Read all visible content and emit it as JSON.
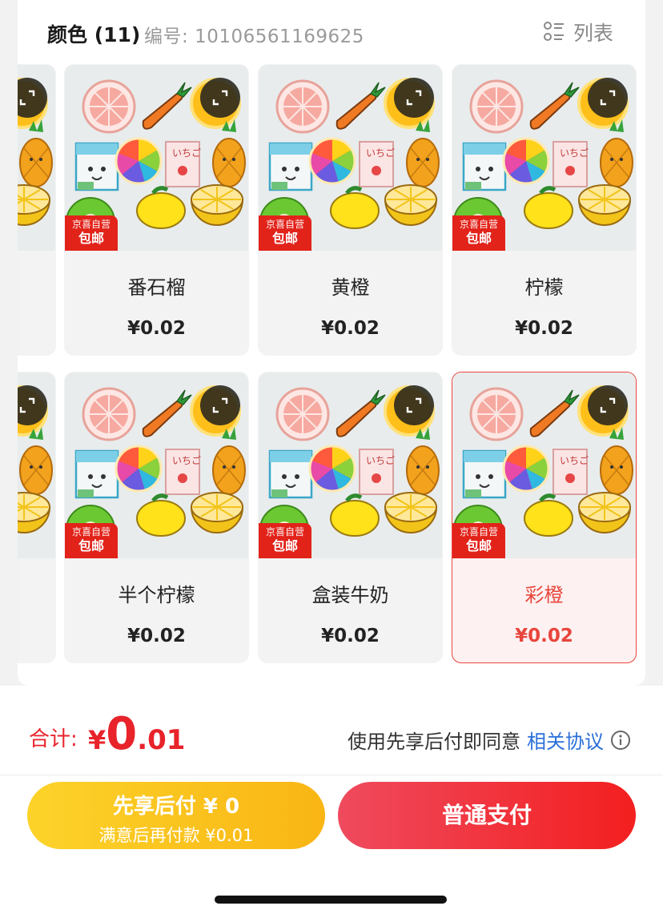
{
  "header": {
    "title": "颜色 (11)",
    "code_label": "编号:",
    "code_value": "10106561169625",
    "list_label": "列表"
  },
  "badge": {
    "top": "京喜自营",
    "bottom": "包邮"
  },
  "cards": [
    {
      "name": "番石榴",
      "price": "¥0.02",
      "selected": false
    },
    {
      "name": "黄橙",
      "price": "¥0.02",
      "selected": false
    },
    {
      "name": "柠檬",
      "price": "¥0.02",
      "selected": false
    },
    {
      "name": "半个柠檬",
      "price": "¥0.02",
      "selected": false
    },
    {
      "name": "盒装牛奶",
      "price": "¥0.02",
      "selected": false
    },
    {
      "name": "彩橙",
      "price": "¥0.02",
      "selected": true
    }
  ],
  "total": {
    "label": "合计:",
    "currency": "¥",
    "integer": "0",
    "decimal": ".01"
  },
  "agreement": {
    "text": "使用先享后付即同意",
    "link": "相关协议"
  },
  "buttons": {
    "pay_later_main": "先享后付 ¥ 0",
    "pay_later_sub": "满意后再付款 ¥0.01",
    "pay_normal": "普通支付"
  },
  "colors": {
    "accent_red": "#e8232a",
    "link_blue": "#2a6fd8",
    "pay_later_gradient": [
      "#fcd32a",
      "#f9b514"
    ],
    "pay_normal_gradient": [
      "#ef4a5e",
      "#f31f1f"
    ]
  }
}
